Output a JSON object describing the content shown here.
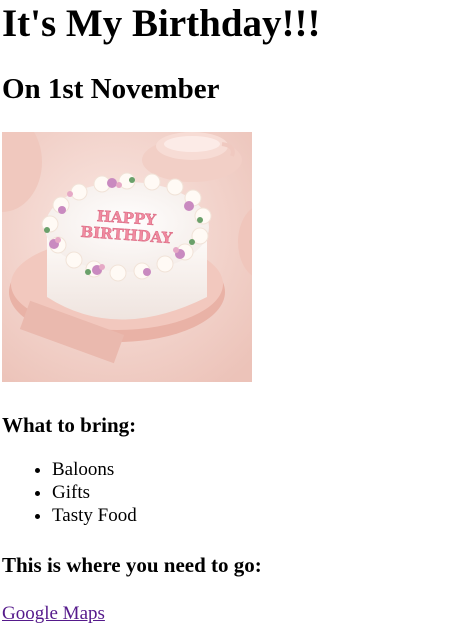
{
  "page": {
    "title": "It's My Birthday!!!",
    "date_heading": "On 1st November",
    "cake_image": {
      "icon": "birthday-cake-photo",
      "text": "HAPPY BIRTHDAY",
      "colors": {
        "background": "#f6d8d2",
        "plate": "#efc2b8",
        "cake": "#fbf7f4",
        "lettering": "#f08aa0",
        "flowers": "#c77fb8",
        "leaves": "#6aa06a"
      }
    },
    "bring_heading": "What to bring:",
    "bring_items": [
      "Baloons",
      "Gifts",
      "Tasty Food"
    ],
    "location_heading": "This is where you need to go:",
    "map_link_label": "Google Maps",
    "colors": {
      "visited_link": "#551a8b"
    }
  }
}
